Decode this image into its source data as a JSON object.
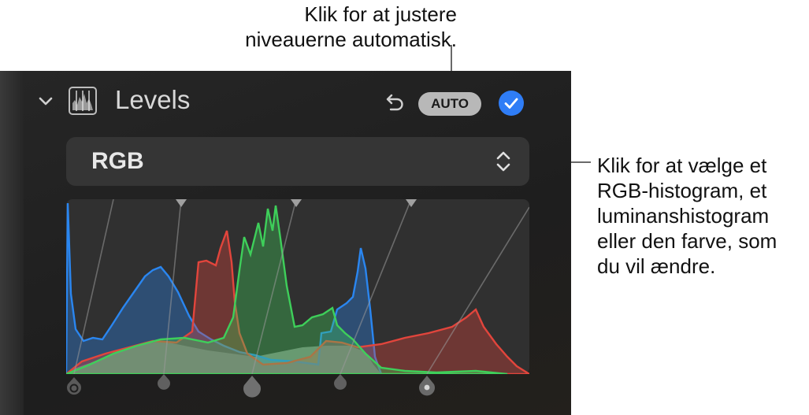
{
  "callouts": {
    "top": [
      "Klik for at justere",
      "niveauerne automatisk."
    ],
    "right": [
      "Klik for at vælge et",
      "RGB-histogram, et",
      "luminanshistogram",
      "eller den farve, som",
      "du vil ændre."
    ]
  },
  "panel": {
    "title": "Levels",
    "auto_label": "AUTO",
    "channel": {
      "selected": "RGB"
    },
    "icons": {
      "collapse": "chevron-down-icon",
      "section": "levels-histogram-icon",
      "reset": "undo-icon",
      "enabled": "checkmark-circle-icon",
      "select": "up-down-chevron-icon"
    },
    "colors": {
      "accent": "#2f7df6",
      "red": "#e2453c",
      "green": "#3ecf5a",
      "blue": "#2a86f0"
    }
  }
}
